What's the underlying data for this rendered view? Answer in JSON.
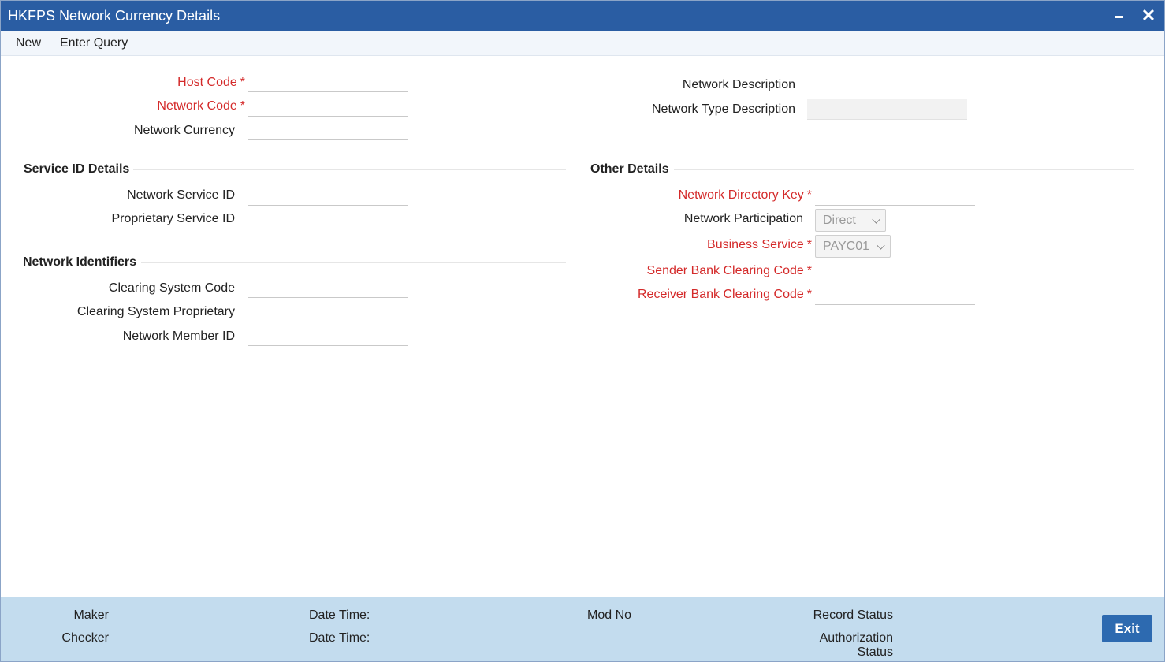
{
  "window": {
    "title": "HKFPS Network Currency Details",
    "minimize_icon": "minimize-icon",
    "close_glyph": "✕"
  },
  "toolbar": {
    "new_label": "New",
    "enter_query_label": "Enter Query"
  },
  "header_fields": {
    "host_code": {
      "label": "Host Code",
      "value": ""
    },
    "network_code": {
      "label": "Network Code",
      "value": ""
    },
    "network_currency": {
      "label": "Network Currency",
      "value": ""
    },
    "network_description": {
      "label": "Network Description",
      "value": ""
    },
    "network_type_description": {
      "label": "Network Type Description",
      "value": ""
    }
  },
  "required_marker": "*",
  "service_id_details": {
    "title": "Service ID Details",
    "network_service_id": {
      "label": "Network Service ID",
      "value": ""
    },
    "proprietary_service_id": {
      "label": "Proprietary Service ID",
      "value": ""
    }
  },
  "network_identifiers": {
    "title": "Network Identifiers",
    "clearing_system_code": {
      "label": "Clearing System Code",
      "value": ""
    },
    "clearing_system_proprietary": {
      "label": "Clearing System Proprietary",
      "value": ""
    },
    "network_member_id": {
      "label": "Network Member ID",
      "value": ""
    }
  },
  "other_details": {
    "title": "Other Details",
    "network_directory_key": {
      "label": "Network Directory Key",
      "value": ""
    },
    "network_participation": {
      "label": "Network Participation",
      "selected": "Direct"
    },
    "business_service": {
      "label": "Business Service",
      "selected": "PAYC01"
    },
    "sender_bank_clearing_code": {
      "label": "Sender Bank Clearing Code",
      "value": ""
    },
    "receiver_bank_clearing_code": {
      "label": "Receiver Bank Clearing Code",
      "value": ""
    }
  },
  "footer": {
    "maker_label": "Maker",
    "checker_label": "Checker",
    "maker_datetime_label": "Date Time:",
    "checker_datetime_label": "Date Time:",
    "mod_no_label": "Mod No",
    "record_status_label": "Record Status",
    "authorization_label": "Authorization",
    "status_label": "Status",
    "exit_label": "Exit"
  },
  "colors": {
    "title_bar": "#2a5da3",
    "required_text": "#d42a2a",
    "footer_bg": "#c3dcee",
    "exit_button": "#2d6ab0"
  }
}
